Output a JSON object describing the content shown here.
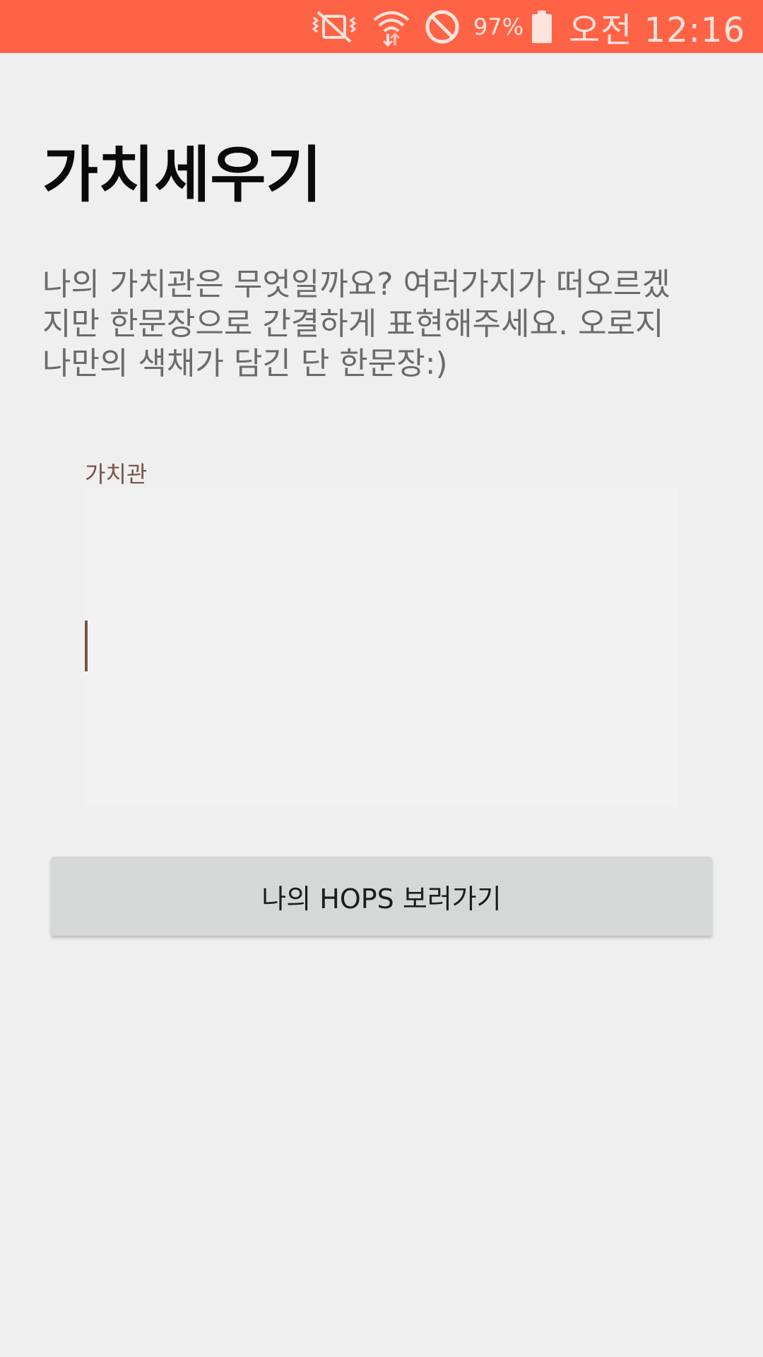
{
  "status_bar": {
    "icons": [
      "mute-vibrate-icon",
      "wifi-icon",
      "do-not-disturb-icon",
      "battery-icon"
    ],
    "battery": "97%",
    "time": "오전 12:16",
    "colors": {
      "background": "#ff6346",
      "foreground": "#ffe3dd"
    }
  },
  "page": {
    "title": "가치세우기",
    "description": "나의 가치관은 무엇일까요? 여러가지가 떠오르겠지만 한문장으로 간결하게 표현해주세요. 오로지 나만의 색채가 담긴 단 한문장:)"
  },
  "form": {
    "value_label": "가치관",
    "value_input": "",
    "accent_color": "#795548"
  },
  "actions": {
    "view_hops_label": "나의 HOPS 보러가기"
  }
}
